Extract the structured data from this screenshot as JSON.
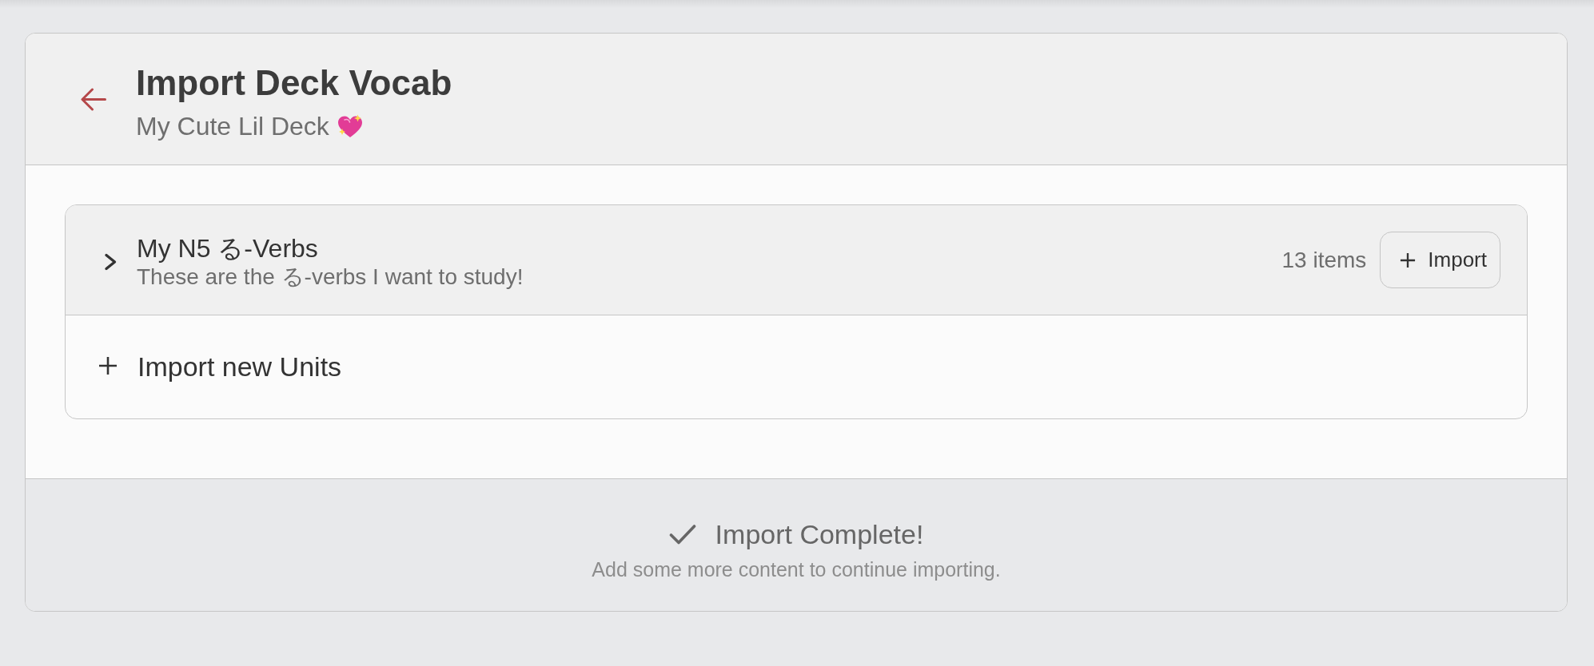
{
  "header": {
    "title": "Import Deck Vocab",
    "subtitle": "My Cute Lil Deck"
  },
  "units": [
    {
      "title": "My N5 る-Verbs",
      "description": "These are the る-verbs I want to study!",
      "count": "13 items",
      "expanded": false,
      "action": "Import"
    }
  ],
  "add_units": {
    "label": "Import new Units"
  },
  "footer": {
    "status": "Import Complete!",
    "hint": "Add some more content to continue importing."
  }
}
